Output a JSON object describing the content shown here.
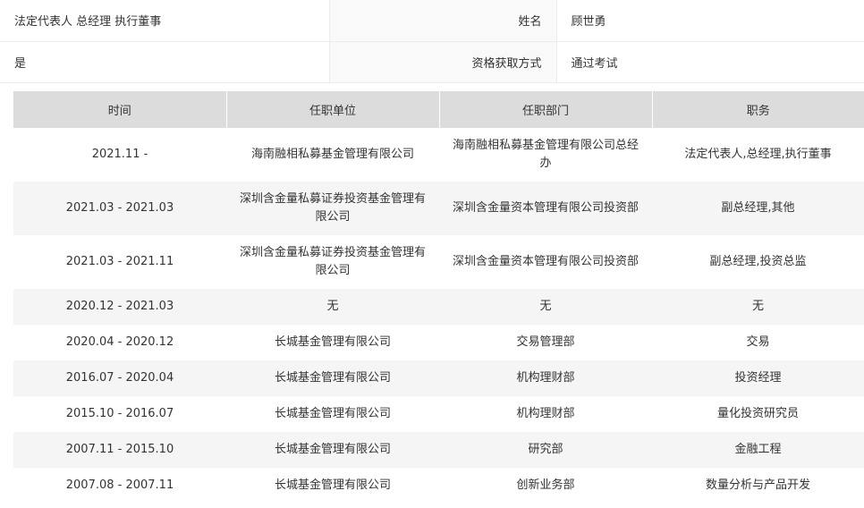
{
  "info": {
    "row1": {
      "left": "法定代表人 总经理 执行董事",
      "label": "姓名",
      "value": "顾世勇"
    },
    "row2": {
      "left": "是",
      "label": "资格获取方式",
      "value": "通过考试"
    }
  },
  "history": {
    "headers": [
      "时间",
      "任职单位",
      "任职部门",
      "职务"
    ],
    "rows": [
      [
        "2021.11 -",
        "海南融相私募基金管理有限公司",
        "海南融相私募基金管理有限公司总经办",
        "法定代表人,总经理,执行董事"
      ],
      [
        "2021.03 - 2021.03",
        "深圳含金量私募证券投资基金管理有限公司",
        "深圳含金量资本管理有限公司投资部",
        "副总经理,其他"
      ],
      [
        "2021.03 - 2021.11",
        "深圳含金量私募证券投资基金管理有限公司",
        "深圳含金量资本管理有限公司投资部",
        "副总经理,投资总监"
      ],
      [
        "2020.12 - 2021.03",
        "无",
        "无",
        "无"
      ],
      [
        "2020.04 - 2020.12",
        "长城基金管理有限公司",
        "交易管理部",
        "交易"
      ],
      [
        "2016.07 - 2020.04",
        "长城基金管理有限公司",
        "机构理财部",
        "投资经理"
      ],
      [
        "2015.10 - 2016.07",
        "长城基金管理有限公司",
        "机构理财部",
        "量化投资研究员"
      ],
      [
        "2007.11 - 2015.10",
        "长城基金管理有限公司",
        "研究部",
        "金融工程"
      ],
      [
        "2007.08 - 2007.11",
        "长城基金管理有限公司",
        "创新业务部",
        "数量分析与产品开发"
      ]
    ]
  }
}
